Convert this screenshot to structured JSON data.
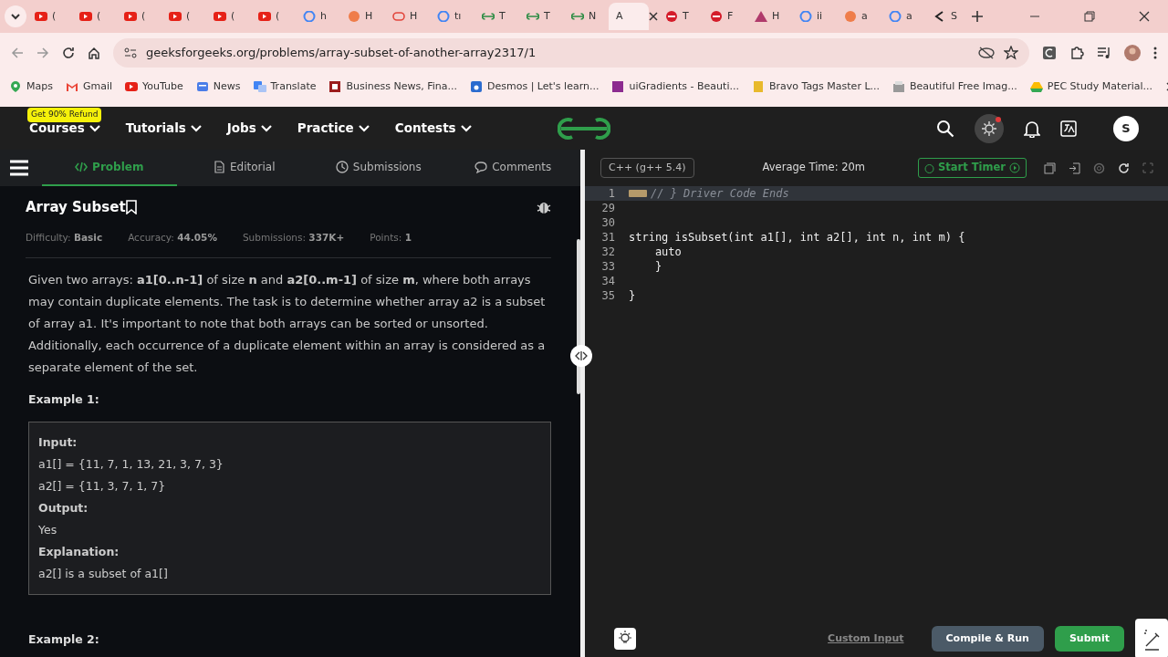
{
  "browser": {
    "tabs": [
      {
        "label": "(",
        "selected": false
      },
      {
        "label": "(",
        "selected": false
      },
      {
        "label": "(",
        "selected": false
      },
      {
        "label": "(",
        "selected": false
      },
      {
        "label": "(",
        "selected": false
      },
      {
        "label": "(",
        "selected": false
      },
      {
        "label": "h",
        "selected": false
      },
      {
        "label": "H",
        "selected": false
      },
      {
        "label": "H",
        "selected": false
      },
      {
        "label": "tı",
        "selected": false
      },
      {
        "label": "T",
        "selected": false
      },
      {
        "label": "T",
        "selected": false
      },
      {
        "label": "N",
        "selected": false
      },
      {
        "label": "A",
        "selected": true
      },
      {
        "label": "T",
        "selected": false
      },
      {
        "label": "F",
        "selected": false
      },
      {
        "label": "H",
        "selected": false
      },
      {
        "label": "ii",
        "selected": false
      },
      {
        "label": "a",
        "selected": false
      },
      {
        "label": "a",
        "selected": false
      },
      {
        "label": "S",
        "selected": false
      }
    ],
    "url": "geeksforgeeks.org/problems/array-subset-of-another-array2317/1",
    "bookmarks": [
      "Maps",
      "Gmail",
      "YouTube",
      "News",
      "Translate",
      "Business News, Fina...",
      "Desmos | Let's learn...",
      "uiGradients - Beauti...",
      "Bravo Tags Master L...",
      "Beautiful Free Imag...",
      "PEC Study Material..."
    ]
  },
  "site_nav": {
    "promo": "Get 90% Refund",
    "items": [
      "Courses",
      "Tutorials",
      "Jobs",
      "Practice",
      "Contests"
    ],
    "avatar": "S"
  },
  "problem_tabs": [
    {
      "label": "Problem",
      "selected": true
    },
    {
      "label": "Editorial",
      "selected": false
    },
    {
      "label": "Submissions",
      "selected": false
    },
    {
      "label": "Comments",
      "selected": false
    }
  ],
  "problem": {
    "title": "Array Subset",
    "meta": [
      {
        "label": "Difficulty:",
        "value": "Basic"
      },
      {
        "label": "Accuracy:",
        "value": "44.05%"
      },
      {
        "label": "Submissions:",
        "value": "337K+"
      },
      {
        "label": "Points:",
        "value": "1"
      }
    ],
    "description": "Given two arrays: **a1[0..n-1]** of size **n** and **a2[0..m-1]** of size **m**, where both arrays may contain duplicate elements. The task is to determine whether array a2 is a subset of array a1. It's important to note that both arrays can be sorted or unsorted. Additionally, each occurrence of a duplicate element within an array is considered as a separate element of the set.",
    "example_heading": "Example 1:",
    "example_lines": [
      {
        "kind": "label",
        "text": "Input:"
      },
      {
        "kind": "code",
        "text": "a1[] = {11, 7, 1, 13, 21, 3, 7, 3}"
      },
      {
        "kind": "code",
        "text": "a2[] = {11, 3, 7, 1, 7}"
      },
      {
        "kind": "label",
        "text": "Output:"
      },
      {
        "kind": "code",
        "text": "Yes"
      },
      {
        "kind": "label",
        "text": "Explanation:"
      },
      {
        "kind": "code",
        "text": "a2[] is a subset of a1[]"
      }
    ],
    "next_heading": "Example 2:"
  },
  "editor": {
    "language": "C++ (g++ 5.4)",
    "average_time": "Average Time: 20m",
    "timer": "Start Timer",
    "lines": [
      {
        "number": "1",
        "text": "// } Driver Code Ends",
        "kind": "folded"
      },
      {
        "number": "29",
        "kind": "code"
      },
      {
        "number": "30",
        "kind": "code"
      },
      {
        "number": "31",
        "text": "string isSubset(int a1[], int a2[], int n, int m) {",
        "kind": "code"
      },
      {
        "number": "32",
        "text": "    auto",
        "kind": "code"
      },
      {
        "number": "33",
        "text": "    }",
        "kind": "code"
      },
      {
        "number": "34",
        "kind": "code"
      },
      {
        "number": "35",
        "text": "}",
        "kind": "code"
      }
    ],
    "custom_input": "Custom Input",
    "compile": "Compile & Run",
    "submit": "Submit"
  }
}
